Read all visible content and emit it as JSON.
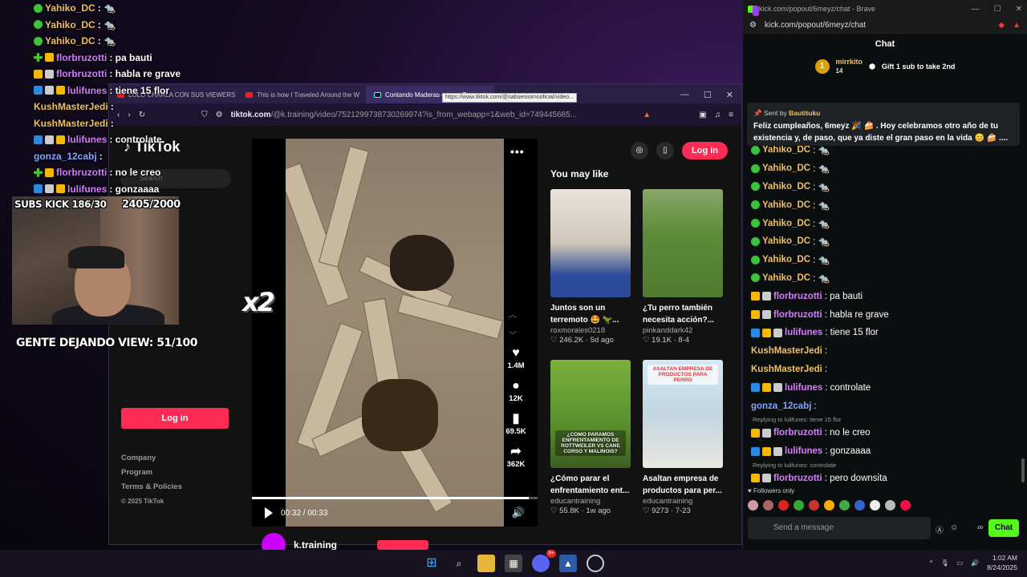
{
  "overlay_chat": [
    {
      "badges": [
        "g"
      ],
      "user": "Yahiko_DC",
      "msg": ": 🐀",
      "color": "gold"
    },
    {
      "badges": [
        "g"
      ],
      "user": "Yahiko_DC",
      "msg": ": 🐀",
      "color": "gold"
    },
    {
      "badges": [
        "g"
      ],
      "user": "Yahiko_DC",
      "msg": ": 🐀",
      "color": "gold"
    },
    {
      "badges": [
        "p",
        "c"
      ],
      "user": "florbruzotti",
      "msg": ": pa bauti",
      "color": "pink"
    },
    {
      "badges": [
        "c",
        "w"
      ],
      "user": "florbruzotti",
      "msg": ": habla re grave",
      "color": "pink"
    },
    {
      "badges": [
        "b",
        "w",
        "c"
      ],
      "user": "lulifunes",
      "msg": ": tiene 15 flor",
      "color": "pink"
    },
    {
      "badges": [],
      "user": "KushMasterJedi",
      "msg": ":",
      "color": "gold"
    },
    {
      "badges": [],
      "user": "KushMasterJedi",
      "msg": ":",
      "color": "gold"
    },
    {
      "badges": [
        "b",
        "w",
        "c"
      ],
      "user": "lulifunes",
      "msg": ": controlate",
      "color": "pink"
    },
    {
      "badges": [],
      "user": "gonza_12cabj",
      "msg": ":",
      "color": "blue"
    },
    {
      "badges": [
        "p",
        "c"
      ],
      "user": "florbruzotti",
      "msg": ": no le creo",
      "color": "pink"
    },
    {
      "badges": [
        "b",
        "w",
        "c"
      ],
      "user": "lulifunes",
      "msg": ": gonzaaaa",
      "color": "pink"
    }
  ],
  "cam": {
    "subs": "SUBS KICK 186/30",
    "goal": "2405/2000",
    "viewers": "GENTE DEJANDO VIEW: 51/100",
    "x2": "x2"
  },
  "browser": {
    "tabs": [
      "LOLO CHARLA CON SUS VIEWERS (j",
      "This is how I Traveled Around the W",
      "Contando Maderas con un Perr"
    ],
    "url_main": "tiktok.com",
    "url_rest": "/@k.training/video/7521299738730269974?is_from_webapp=1&web_id=749445685...",
    "tooltip": "https://www.tiktok.com/@sabuenisimooficial/video..."
  },
  "tiktok": {
    "logo": "TikTok",
    "search_placeholder": "Search",
    "login": "Log in",
    "login_top": "Log in",
    "footer": [
      "Company",
      "Program",
      "Terms & Policies"
    ],
    "copyright": "© 2025 TikTok",
    "video_time": "00:32 / 00:33",
    "likes": "1.4M",
    "comments": "12K",
    "saves": "69.5K",
    "shares": "362K",
    "creator": "k.training",
    "you_may_like": "You may like",
    "recs": [
      {
        "title": "Juntos son un terremoto 🤩 🦖...",
        "author": "roxmorales0218",
        "meta": "♡ 246.2K · 5d ago"
      },
      {
        "title": "¿Tu perro también necesita acción?...",
        "author": "pinkanddark42",
        "meta": "♡ 19.1K · 8-4"
      },
      {
        "title": "¿Cómo parar el enfrentamiento ent...",
        "author": "educantraining",
        "meta": "♡ 55.8K · 1w ago",
        "caption": "¿COMO PARAMOS ENFRENTAMIENTO DE ROTTWEILER VS CANE CORSO Y MALINOIS?"
      },
      {
        "title": "Asaltan empresa de productos para per...",
        "author": "educantraining",
        "meta": "♡ 9273 · 7-23",
        "caption": "ASALTAN EMPRESA DE PRODUCTOS PARA PERRO"
      }
    ]
  },
  "kick": {
    "window_title": "kick.com/popout/6meyz/chat - Brave",
    "address": "kick.com/popout/6meyz/chat",
    "header": "Chat",
    "top_gifter": {
      "rank": "1",
      "name": "mirrkito",
      "count": "14",
      "cta": "Gift 1 sub to take 2nd"
    },
    "pinned": {
      "sent_by": "Sent by",
      "sender": "Bautituku",
      "text": "Feliz cumpleaños, 6meyz 🎉 🍰 . Hoy celebramos otro año de tu existencia y, de paso, que ya diste el gran paso en la vida 😊 🍰 ...."
    },
    "messages": [
      {
        "badges": [
          "g"
        ],
        "user": "Yahiko_DC",
        "msg": ": 🐀",
        "uc": "u-y"
      },
      {
        "badges": [
          "g"
        ],
        "user": "Yahiko_DC",
        "msg": ": 🐀",
        "uc": "u-y"
      },
      {
        "badges": [
          "g"
        ],
        "user": "Yahiko_DC",
        "msg": ": 🐀",
        "uc": "u-y"
      },
      {
        "badges": [
          "g"
        ],
        "user": "Yahiko_DC",
        "msg": ": 🐀",
        "uc": "u-y"
      },
      {
        "badges": [
          "g"
        ],
        "user": "Yahiko_DC",
        "msg": ": 🐀",
        "uc": "u-y"
      },
      {
        "badges": [
          "g"
        ],
        "user": "Yahiko_DC",
        "msg": ": 🐀",
        "uc": "u-y"
      },
      {
        "badges": [
          "g"
        ],
        "user": "Yahiko_DC",
        "msg": ": 🐀",
        "uc": "u-y"
      },
      {
        "badges": [
          "g"
        ],
        "user": "Yahiko_DC",
        "msg": ": 🐀",
        "uc": "u-y"
      },
      {
        "badges": [
          "c",
          "w"
        ],
        "user": "florbruzotti",
        "msg": ": pa bauti",
        "uc": "u-p"
      },
      {
        "badges": [
          "c",
          "w"
        ],
        "user": "florbruzotti",
        "msg": ": habla re grave",
        "uc": "u-p"
      },
      {
        "badges": [
          "b",
          "c",
          "w"
        ],
        "user": "lulifunes",
        "msg": ": tiene 15 flor",
        "uc": "u-p"
      },
      {
        "badges": [],
        "user": "KushMasterJedi",
        "msg": ":",
        "uc": "u-y"
      },
      {
        "badges": [],
        "user": "KushMasterJedi",
        "msg": ":",
        "uc": "u-y"
      },
      {
        "badges": [
          "b",
          "c",
          "w"
        ],
        "user": "lulifunes",
        "msg": ": controlate",
        "uc": "u-p"
      },
      {
        "badges": [],
        "user": "gonza_12cabj",
        "msg": ":",
        "uc": "u-b"
      },
      {
        "reply": "Replying to lulifunes: tiene 15 flor",
        "badges": [
          "c",
          "w"
        ],
        "user": "florbruzotti",
        "msg": ": no le creo",
        "uc": "u-p"
      },
      {
        "badges": [
          "b",
          "c",
          "w"
        ],
        "user": "lulifunes",
        "msg": ": gonzaaaa",
        "uc": "u-p"
      },
      {
        "reply": "Replying to lulifunes: controlate",
        "badges": [
          "c",
          "w"
        ],
        "user": "florbruzotti",
        "msg": ": pero downsita",
        "uc": "u-p"
      }
    ],
    "followers_only": "♥ Followers only",
    "input_placeholder": "Send a message",
    "chat_button": "Chat"
  },
  "taskbar": {
    "time": "1:02 AM",
    "date": "8/24/2025",
    "discord_badge": "9+"
  }
}
